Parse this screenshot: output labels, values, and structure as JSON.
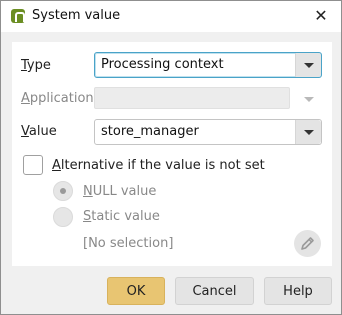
{
  "titlebar": {
    "icon": "app-logo-icon",
    "title": "System value",
    "close_glyph": "✕"
  },
  "form": {
    "type": {
      "label_u": "T",
      "label_rest": "ype",
      "value": "Processing context"
    },
    "application": {
      "label_u": "A",
      "label_rest": "pplication",
      "value": ""
    },
    "value": {
      "label_u": "V",
      "label_rest": "alue",
      "value": "store_manager"
    },
    "alternative": {
      "label_u": "A",
      "label_rest": "lternative if the value is not set",
      "checked": false
    },
    "null_value": {
      "label_u": "N",
      "label_rest": "ULL value",
      "checked": true
    },
    "static_value": {
      "label_u": "S",
      "label_rest": "tatic value",
      "checked": false
    },
    "selection_text": "[No selection]",
    "edit_icon": "pencil-icon"
  },
  "buttons": {
    "ok": "OK",
    "cancel": "Cancel",
    "help": "Help"
  },
  "colors": {
    "ok_button": "#e8c572",
    "focus_border": "#4aa3c8"
  }
}
